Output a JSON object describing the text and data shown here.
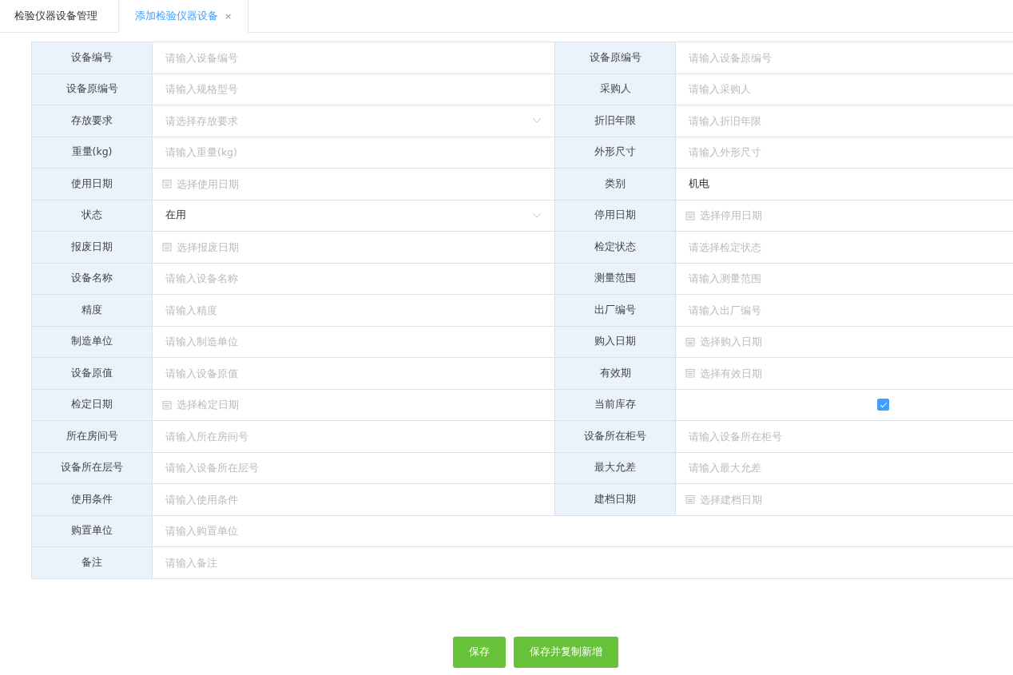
{
  "tabs": [
    {
      "label": "检验仪器设备管理",
      "selected": false,
      "closable": false
    },
    {
      "label": "添加检验仪器设备",
      "selected": true,
      "closable": true,
      "close": "×"
    }
  ],
  "form": {
    "rows": [
      {
        "cells": [
          {
            "label": "设备编号",
            "kind": "input",
            "placeholder": "请输入设备编号"
          },
          {
            "label": "设备原编号",
            "kind": "input",
            "placeholder": "请输入设备原编号"
          }
        ]
      },
      {
        "cells": [
          {
            "label": "设备原编号",
            "kind": "input",
            "placeholder": "请输入规格型号"
          },
          {
            "label": "采购人",
            "kind": "input",
            "placeholder": "请输入采购人"
          }
        ]
      },
      {
        "cells": [
          {
            "label": "存放要求",
            "kind": "select",
            "placeholder": "请选择存放要求"
          },
          {
            "label": "折旧年限",
            "kind": "input",
            "placeholder": "请输入折旧年限"
          }
        ]
      },
      {
        "cells": [
          {
            "label": "重量(kg)",
            "kind": "input",
            "placeholder": "请输入重量(kg)"
          },
          {
            "label": "外形尺寸",
            "kind": "input",
            "placeholder": "请输入外形尺寸"
          }
        ]
      },
      {
        "cells": [
          {
            "label": "使用日期",
            "kind": "date",
            "placeholder": "选择使用日期"
          },
          {
            "label": "类别",
            "kind": "text",
            "value": "机电"
          }
        ]
      },
      {
        "cells": [
          {
            "label": "状态",
            "kind": "select",
            "value": "在用"
          },
          {
            "label": "停用日期",
            "kind": "date",
            "placeholder": "选择停用日期"
          }
        ]
      },
      {
        "cells": [
          {
            "label": "报废日期",
            "kind": "date",
            "placeholder": "选择报废日期"
          },
          {
            "label": "检定状态",
            "kind": "input",
            "placeholder": "请选择检定状态"
          }
        ]
      },
      {
        "cells": [
          {
            "label": "设备名称",
            "kind": "input",
            "placeholder": "请输入设备名称"
          },
          {
            "label": "测量范围",
            "kind": "input",
            "placeholder": "请输入测量范围"
          }
        ]
      },
      {
        "cells": [
          {
            "label": "精度",
            "kind": "input",
            "placeholder": "请输入精度"
          },
          {
            "label": "出厂编号",
            "kind": "input",
            "placeholder": "请输入出厂编号"
          }
        ]
      },
      {
        "cells": [
          {
            "label": "制造单位",
            "kind": "input",
            "placeholder": "请输入制造单位"
          },
          {
            "label": "购入日期",
            "kind": "date",
            "placeholder": "选择购入日期"
          }
        ]
      },
      {
        "cells": [
          {
            "label": "设备原值",
            "kind": "input",
            "placeholder": "请输入设备原值"
          },
          {
            "label": "有效期",
            "kind": "date",
            "placeholder": "选择有效日期"
          }
        ]
      },
      {
        "cells": [
          {
            "label": "检定日期",
            "kind": "date",
            "placeholder": "选择检定日期"
          },
          {
            "label": "当前库存",
            "kind": "checkbox",
            "checked": true
          }
        ]
      },
      {
        "cells": [
          {
            "label": "所在房间号",
            "kind": "input",
            "placeholder": "请输入所在房间号"
          },
          {
            "label": "设备所在柜号",
            "kind": "input",
            "placeholder": "请输入设备所在柜号"
          }
        ]
      },
      {
        "cells": [
          {
            "label": "设备所在层号",
            "kind": "input",
            "placeholder": "请输入设备所在层号"
          },
          {
            "label": "最大允差",
            "kind": "input",
            "placeholder": "请输入最大允差"
          }
        ]
      },
      {
        "cells": [
          {
            "label": "使用条件",
            "kind": "input",
            "placeholder": "请输入使用条件"
          },
          {
            "label": "建档日期",
            "kind": "date",
            "placeholder": "选择建档日期"
          }
        ]
      },
      {
        "cells": [
          {
            "label": "购置单位",
            "kind": "input",
            "placeholder": "请输入购置单位"
          }
        ]
      },
      {
        "cells": [
          {
            "label": "备注",
            "kind": "input",
            "placeholder": "请输入备注"
          }
        ]
      }
    ]
  },
  "buttons": [
    {
      "label": "保存"
    },
    {
      "label": "保存并复制新增"
    }
  ]
}
